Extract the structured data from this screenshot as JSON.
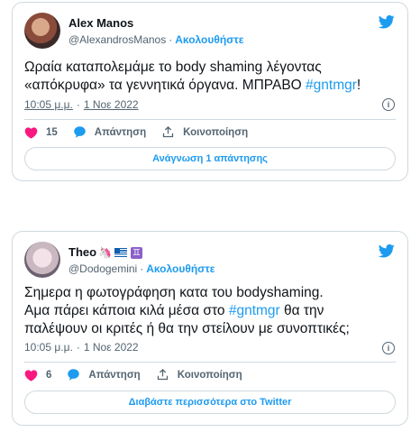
{
  "tweets": [
    {
      "author": {
        "name": "Alex Manos",
        "handle": "@AlexandrosManos",
        "follow_label": "Ακολουθήστε"
      },
      "text": "Ωραία καταπολεμάμε το body shaming λέγοντας «απόκρυφα» τα γεννητικά όργανα. ΜΠΡΑΒΟ ",
      "hashtag": "#gntmgr",
      "text_suffix": "!",
      "time": "10:05 μ.μ.",
      "date": "1 Νοε 2022",
      "likes": "15",
      "reply_label": "Απάντηση",
      "share_label": "Κοινοποίηση",
      "button_label": "Ανάγνωση 1 απάντησης"
    },
    {
      "author": {
        "name": "Theo",
        "handle": "@Dodogemini",
        "follow_label": "Ακολουθήστε",
        "name_emojis": [
          "unicorn-emoji",
          "greek-flag-emoji",
          "gemini-emoji"
        ]
      },
      "text_line1": "Σημερα η φωτογράφηση κατα του bodyshaming.",
      "text_line2_pre": "Αμα πάρει κάποια  κιλά μέσα στο ",
      "hashtag": "#gntmgr",
      "text_line2_post": " θα την",
      "text_line3": "παλέψουν οι κριτές ή θα την στείλουν με συνοπτικές;",
      "time": "10:05 μ.μ.",
      "date": "1 Νοε 2022",
      "likes": "6",
      "reply_label": "Απάντηση",
      "share_label": "Κοινοποίηση",
      "button_label": "Διαβάστε περισσότερα στο Twitter"
    }
  ],
  "colors": {
    "accent": "#1d9bf0",
    "like": "#f91880",
    "muted": "#536471",
    "border": "#cfd9de"
  },
  "icons": [
    "twitter-bird-icon",
    "heart-icon",
    "reply-bubble-icon",
    "share-icon",
    "info-icon"
  ]
}
